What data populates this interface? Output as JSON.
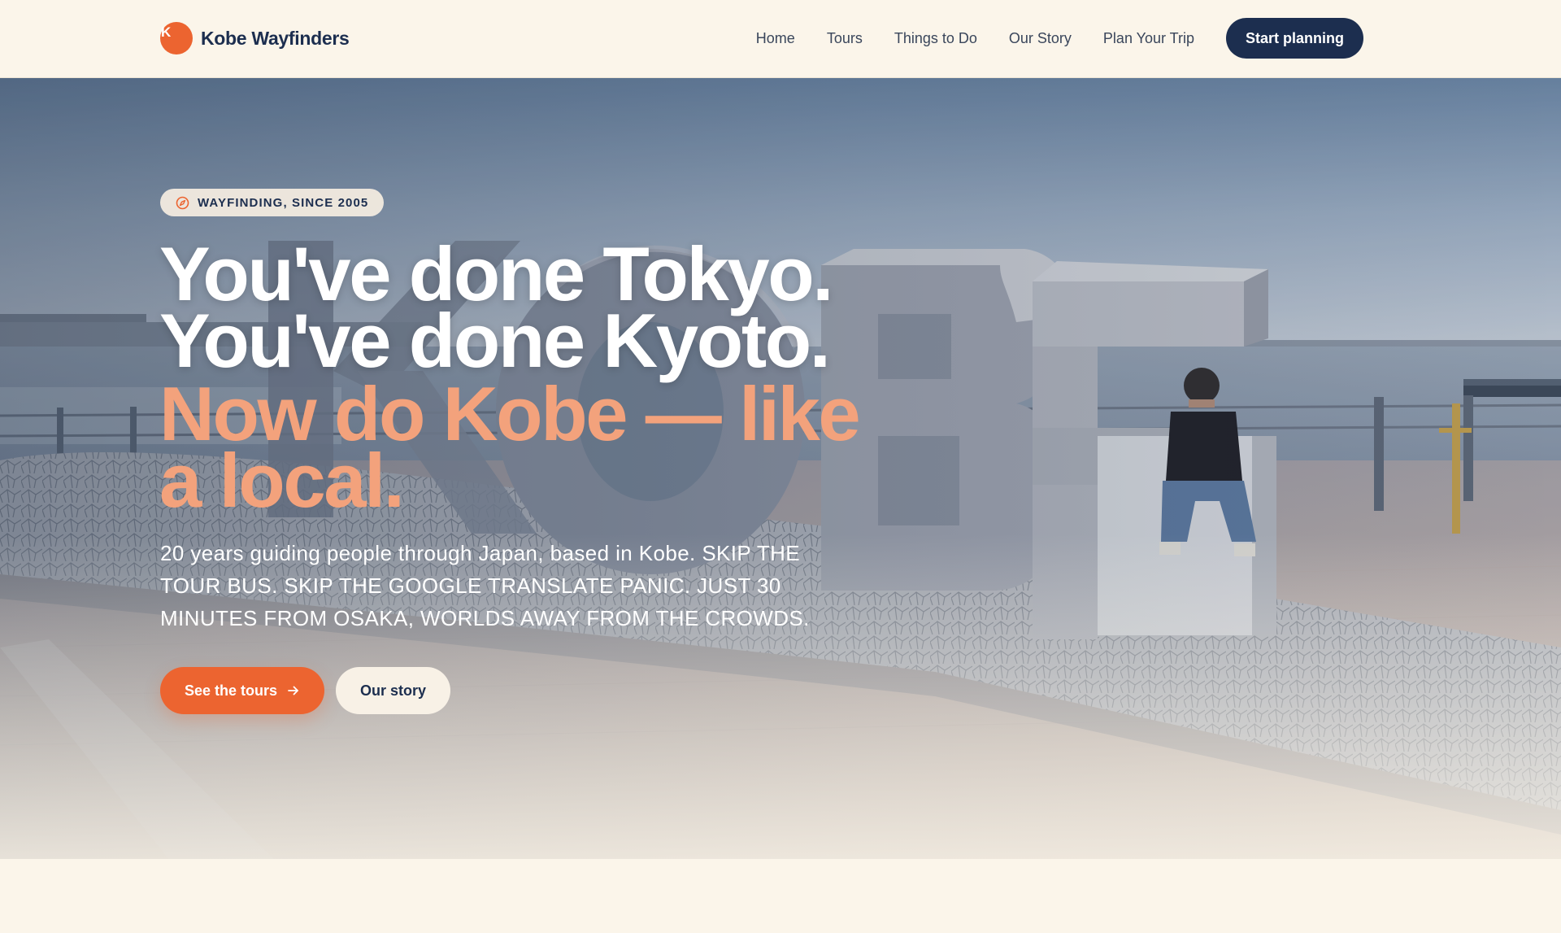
{
  "header": {
    "brand": {
      "mark_letter": "K",
      "name": "Kobe Wayfinders"
    },
    "nav": [
      {
        "label": "Home"
      },
      {
        "label": "Tours"
      },
      {
        "label": "Things to Do"
      },
      {
        "label": "Our Story"
      },
      {
        "label": "Plan Your Trip"
      }
    ],
    "cta_label": "Start planning"
  },
  "hero": {
    "badge": {
      "icon": "compass-icon",
      "text": "WAYFINDING, SINCE 2005"
    },
    "headline": {
      "line1": "You've done Tokyo.",
      "line2": "You've done Kyoto.",
      "accent": "Now do Kobe — like a local."
    },
    "lede": {
      "intro": "20 years guiding people through Japan, based in Kobe.",
      "caps": "Skip the tour bus. Skip the Google Translate panic. Just 30 minutes from Osaka, worlds away from the crowds."
    },
    "primary_button": {
      "label": "See the tours",
      "icon": "arrow-right-icon"
    },
    "secondary_button": {
      "label": "Our story"
    },
    "photo": {
      "sign_letters": [
        "K",
        "O",
        "B",
        "E"
      ]
    }
  },
  "colors": {
    "accent": "#ec6430",
    "accent_light": "#f3a27c",
    "navy": "#1c2e4f",
    "cream": "#fbf5ea"
  }
}
